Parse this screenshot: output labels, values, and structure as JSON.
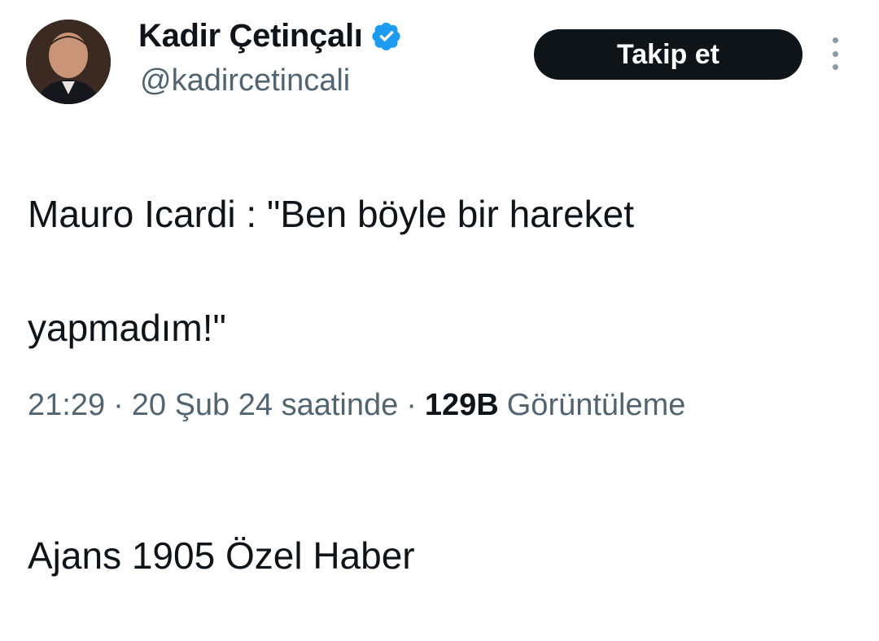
{
  "author": {
    "display_name": "Kadir Çetinçalı",
    "handle": "@kadircetincali",
    "verified": true,
    "verified_color": "#1d9bf0"
  },
  "actions": {
    "follow_label": "Takip et",
    "more_icon": "more-vertical-icon"
  },
  "tweet": {
    "lines": [
      "Mauro Icardi : \"Ben böyle bir hareket",
      "yapmadım!\"",
      "",
      "Ajans 1905 Özel Haber"
    ]
  },
  "meta": {
    "time": "21:29",
    "date": "20 Şub 24 saatinde",
    "views_count": "129B",
    "views_label": "Görüntüleme",
    "separator": "·"
  },
  "colors": {
    "text_primary": "#0f1419",
    "text_secondary": "#536471",
    "button_bg": "#0f1419",
    "button_text": "#ffffff"
  }
}
